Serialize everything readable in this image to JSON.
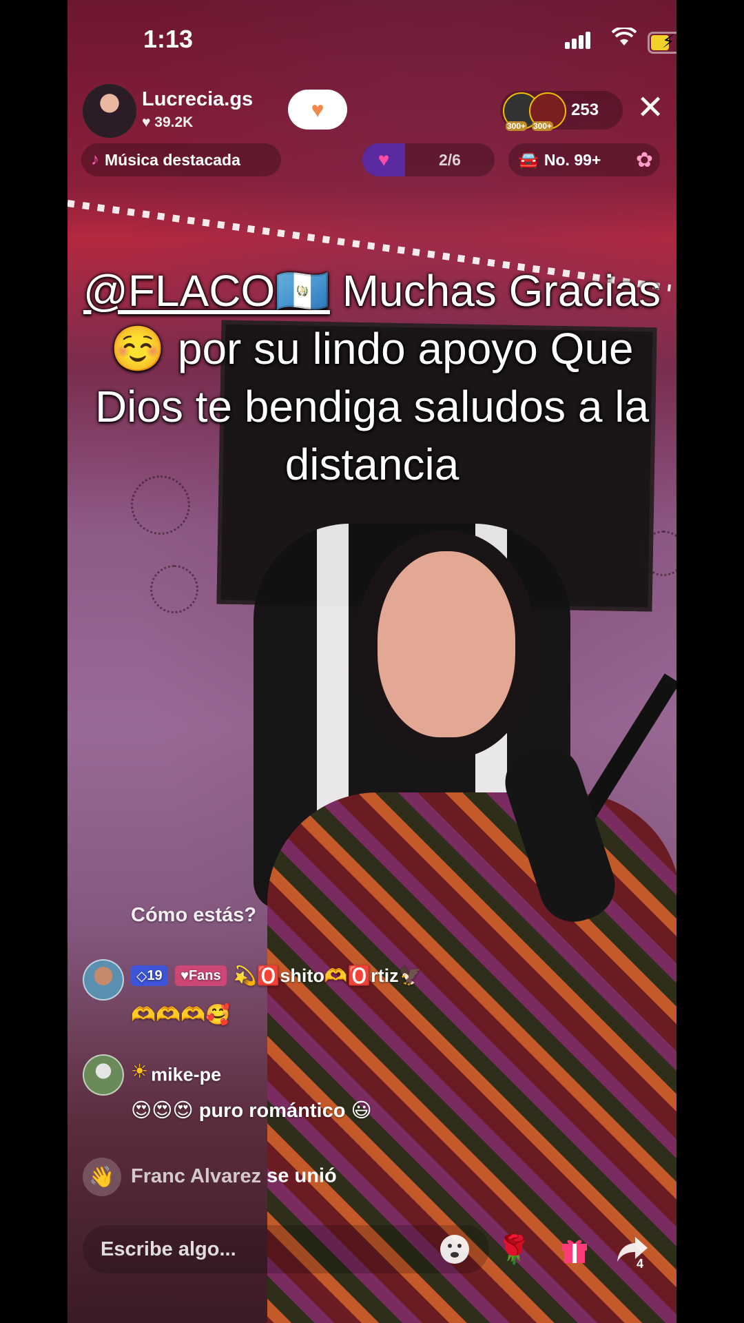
{
  "status_bar": {
    "time": "1:13"
  },
  "header": {
    "host_name": "Lucrecia.gs",
    "host_likes": "♥ 39.2K",
    "viewer_badges": [
      "300+",
      "300+"
    ],
    "viewer_count": "253",
    "close_glyph": "✕"
  },
  "pills": {
    "music_label": "Música destacada",
    "gift_progress": "2/6",
    "rank_label": "No. 99+"
  },
  "caption": {
    "mention": "@FLACO🇬🇹",
    "text": " Muchas Gracias ☺️ por su lindo apoyo Que Dios te bendiga saludos a la distancia"
  },
  "chat": [
    {
      "type": "plain",
      "text": "Cómo estás?"
    },
    {
      "type": "user",
      "level": "19",
      "fans_badge": "Fans",
      "username": "💫🅾️shito🫶🅾️rtiz🦅",
      "message": "🫶🫶🫶🥰"
    },
    {
      "type": "user",
      "username": "mike-pe",
      "message": "😍😍😍  puro romántico 😃"
    }
  ],
  "joined": {
    "who": "Franc Alvarez",
    "action": " se unió"
  },
  "bottom_bar": {
    "input_placeholder": "Escribe algo...",
    "share_count": "4"
  },
  "icons": [
    "music-note-icon",
    "gift-goal-icon",
    "car-icon",
    "flower-icon",
    "wave-icon",
    "emoji-icon",
    "rose-icon",
    "gift-icon",
    "share-icon",
    "close-icon"
  ],
  "colors": {
    "follow_heart": "#f08a4b",
    "level_badge": "#3d55d8",
    "music_note": "#ff5fb8"
  }
}
